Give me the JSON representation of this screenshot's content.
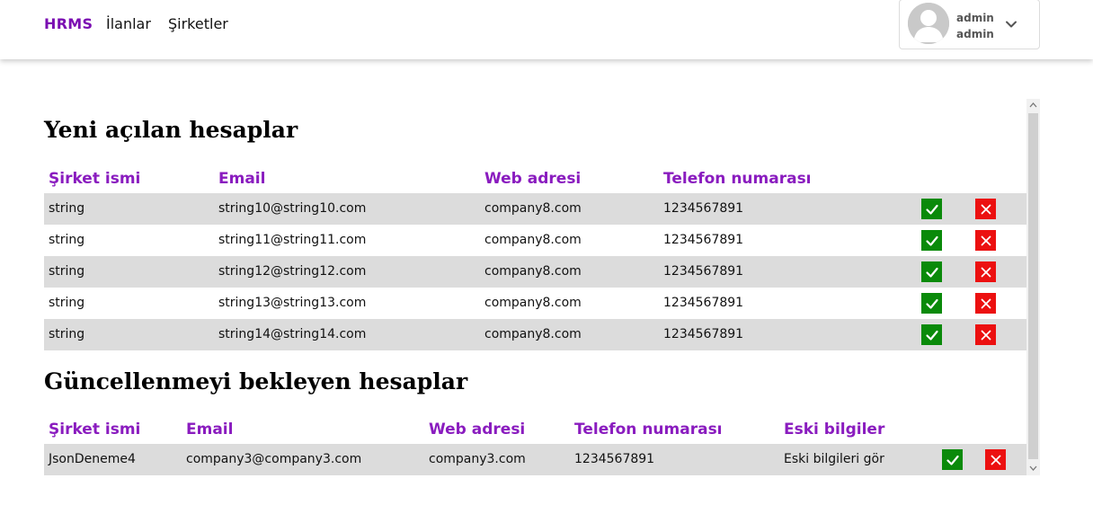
{
  "nav": {
    "brand": "HRMS",
    "links": [
      "İlanlar",
      "Şirketler"
    ]
  },
  "user": {
    "name": "admin",
    "surname": "admin"
  },
  "new_accounts": {
    "title": "Yeni açılan hesaplar",
    "headers": [
      "Şirket ismi",
      "Email",
      "Web adresi",
      "Telefon numarası"
    ],
    "rows": [
      {
        "company": "string",
        "email": "string10@string10.com",
        "web": "company8.com",
        "phone": "1234567891"
      },
      {
        "company": "string",
        "email": "string11@string11.com",
        "web": "company8.com",
        "phone": "1234567891"
      },
      {
        "company": "string",
        "email": "string12@string12.com",
        "web": "company8.com",
        "phone": "1234567891"
      },
      {
        "company": "string",
        "email": "string13@string13.com",
        "web": "company8.com",
        "phone": "1234567891"
      },
      {
        "company": "string",
        "email": "string14@string14.com",
        "web": "company8.com",
        "phone": "1234567891"
      }
    ]
  },
  "pending_updates": {
    "title": "Güncellenmeyi bekleyen hesaplar",
    "headers": [
      "Şirket ismi",
      "Email",
      "Web adresi",
      "Telefon numarası",
      "Eski bilgiler"
    ],
    "rows": [
      {
        "company": "JsonDeneme4",
        "email": "company3@company3.com",
        "web": "company3.com",
        "phone": "1234567891",
        "old_info": "Eski bilgileri gör"
      }
    ]
  },
  "colors": {
    "brand": "#7b0fb2",
    "header_text": "#8a1cbf",
    "approve": "#0a8a0a",
    "reject": "#ec1010",
    "row_stripe": "#dcdcdc"
  },
  "icons": {
    "approve": "check-icon",
    "reject": "close-icon",
    "user_menu": "chevron-down-icon"
  }
}
